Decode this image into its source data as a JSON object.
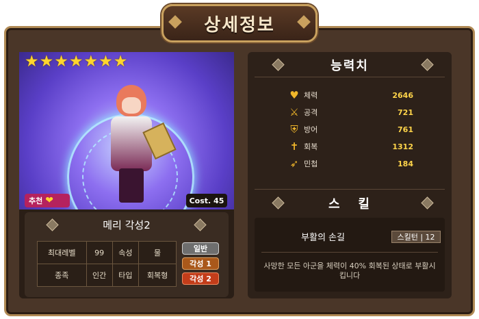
{
  "window": {
    "title": "상세정보"
  },
  "character": {
    "stars": 7,
    "name": "메리 각성2",
    "recommend_label": "추천",
    "cost_label": "Cost. 45"
  },
  "info_table": [
    [
      "최대레벨",
      "99",
      "속성",
      "물"
    ],
    [
      "종족",
      "인간",
      "타입",
      "회복형"
    ]
  ],
  "grade_badges": [
    {
      "label": "일반",
      "color": "#7a7a7a"
    },
    {
      "label": "각성 1",
      "color": "#b4621c"
    },
    {
      "label": "각성 2",
      "color": "#c8401e"
    }
  ],
  "abilities": {
    "header": "능력치",
    "items": [
      {
        "icon": "heart-icon",
        "label": "체력",
        "value": "2646"
      },
      {
        "icon": "sword-icon",
        "label": "공격",
        "value": "721"
      },
      {
        "icon": "shield-icon",
        "label": "방어",
        "value": "761"
      },
      {
        "icon": "cross-icon",
        "label": "회복",
        "value": "1312"
      },
      {
        "icon": "boot-icon",
        "label": "민첩",
        "value": "184"
      }
    ]
  },
  "skill": {
    "header": "스   킬",
    "name": "부활의 손길",
    "turn_label": "스킬턴 | 12",
    "description": "사망한 모든 아군을 체력이 40% 회복된 상태로 부활시킵니다"
  },
  "colors": {
    "frame": "#4a3628",
    "gold": "#c9a15e",
    "value": "#ffd54a"
  }
}
